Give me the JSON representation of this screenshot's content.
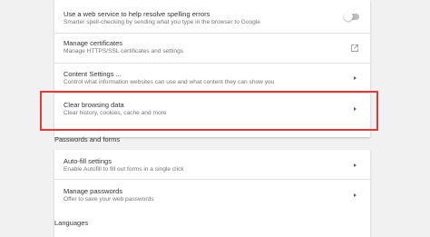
{
  "privacy_card": {
    "spelling": {
      "title": "Use a web service to help resolve spelling errors",
      "subtitle": "Smarter spell-checking by sending what you type in the browser to Google",
      "toggle_on": false
    },
    "certificates": {
      "title": "Manage certificates",
      "subtitle": "Manage HTTPS/SSL certificates and settings",
      "icon": "open-in-new-icon"
    },
    "content_settings": {
      "title": "Content Settings ...",
      "subtitle": "Control what information websites can use and what content they can show you",
      "icon": "chevron-right-icon"
    },
    "clear_browsing": {
      "title": "Clear browsing data",
      "subtitle": "Clear history, cookies, cache and more",
      "icon": "chevron-right-icon"
    }
  },
  "passwords_section": {
    "header": "Passwords and forms",
    "autofill": {
      "title": "Auto-fill settings",
      "subtitle": "Enable Autofill to fill out forms in a single click",
      "icon": "chevron-right-icon"
    },
    "manage_passwords": {
      "title": "Manage passwords",
      "subtitle": "Offer to save your web passwords",
      "icon": "chevron-right-icon"
    }
  },
  "next_section": {
    "header": "Languages"
  },
  "colors": {
    "highlight": "#e53935",
    "background": "#f1f1f1",
    "card": "#ffffff"
  }
}
